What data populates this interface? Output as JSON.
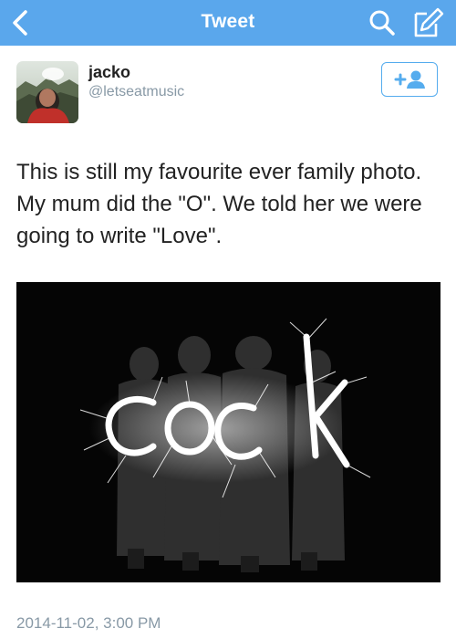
{
  "navbar": {
    "title": "Tweet",
    "back_icon": "chevron-left-icon",
    "search_icon": "search-icon",
    "compose_icon": "compose-icon",
    "background": "#5aa7ec"
  },
  "tweet": {
    "display_name": "jacko",
    "handle": "@letseatmusic",
    "follow_icon": "add-user-icon",
    "text": "This is still my favourite ever family photo. My mum did the \"O\". We told her we were going to write \"Love\".",
    "photo_icon": "sparkler-photo",
    "timestamp": "2014-11-02, 3:00 PM"
  },
  "colors": {
    "accent": "#55acee",
    "muted": "#8899a6",
    "text": "#222222"
  }
}
